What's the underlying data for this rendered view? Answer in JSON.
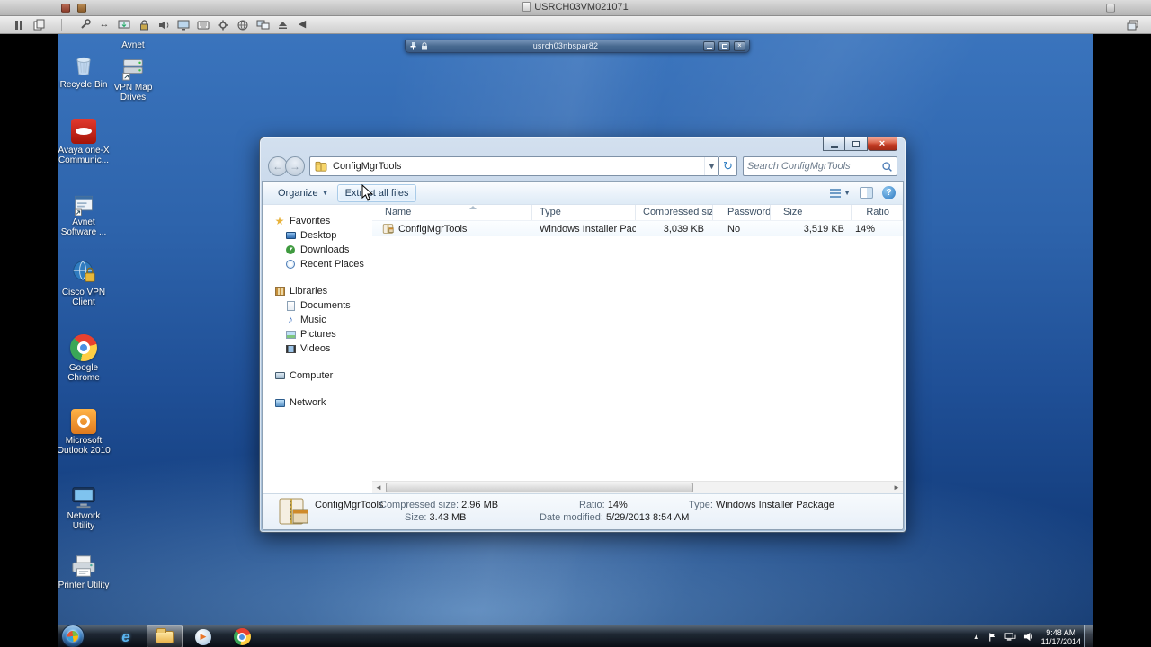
{
  "host": {
    "title": "USRCH03VM021071",
    "toolbar_icons": [
      "pause-icon",
      "copy-icon",
      "wrench-icon",
      "swap-arrows-icon",
      "monitor-download-icon",
      "lock-icon",
      "volume-icon",
      "display-icon",
      "keyboard-icon",
      "gear-icon",
      "globe-icon",
      "displays-icon",
      "eject-icon",
      "back-arrow-icon",
      "window-restore-icon"
    ]
  },
  "connection_bar": {
    "title": "usrch03nbspar82",
    "controls": [
      "pin-icon",
      "minimize-button",
      "restore-button",
      "close-button"
    ]
  },
  "desktop": {
    "icons": [
      {
        "label": "Recycle Bin"
      },
      {
        "label": "Avnet"
      },
      {
        "label": "VPN Map Drives"
      },
      {
        "label": "Avaya one-X Communic..."
      },
      {
        "label": "Avnet Software ..."
      },
      {
        "label": "Cisco VPN Client"
      },
      {
        "label": "Google Chrome"
      },
      {
        "label": "Microsoft Outlook 2010"
      },
      {
        "label": "Network Utility"
      },
      {
        "label": "Printer Utility"
      }
    ]
  },
  "explorer": {
    "address": {
      "crumb": "ConfigMgrTools",
      "search_placeholder": "Search ConfigMgrTools"
    },
    "toolbar": {
      "organize": "Organize",
      "extract_all": "Extract all files"
    },
    "nav": {
      "favorites_label": "Favorites",
      "favorites": [
        "Desktop",
        "Downloads",
        "Recent Places"
      ],
      "libraries_label": "Libraries",
      "libraries": [
        "Documents",
        "Music",
        "Pictures",
        "Videos"
      ],
      "computer_label": "Computer",
      "network_label": "Network"
    },
    "list": {
      "columns": [
        "Name",
        "Type",
        "Compressed size",
        "Password ...",
        "Size",
        "Ratio"
      ],
      "rows": [
        {
          "name": "ConfigMgrTools",
          "type": "Windows Installer Package",
          "compressed_size": "3,039 KB",
          "password": "No",
          "size": "3,519 KB",
          "ratio": "14%"
        }
      ]
    },
    "details": {
      "name": "ConfigMgrTools",
      "compressed_size_label": "Compressed size:",
      "compressed_size": "2.96 MB",
      "size_label": "Size:",
      "size": "3.43 MB",
      "ratio_label": "Ratio:",
      "ratio": "14%",
      "date_modified_label": "Date modified:",
      "date_modified": "5/29/2013 8:54 AM",
      "type_label": "Type:",
      "type": "Windows Installer Package"
    }
  },
  "taskbar": {
    "clock": {
      "time": "9:48 AM",
      "date": "11/17/2014"
    },
    "pinned": [
      "internet-explorer",
      "windows-explorer",
      "media-player",
      "google-chrome"
    ]
  }
}
